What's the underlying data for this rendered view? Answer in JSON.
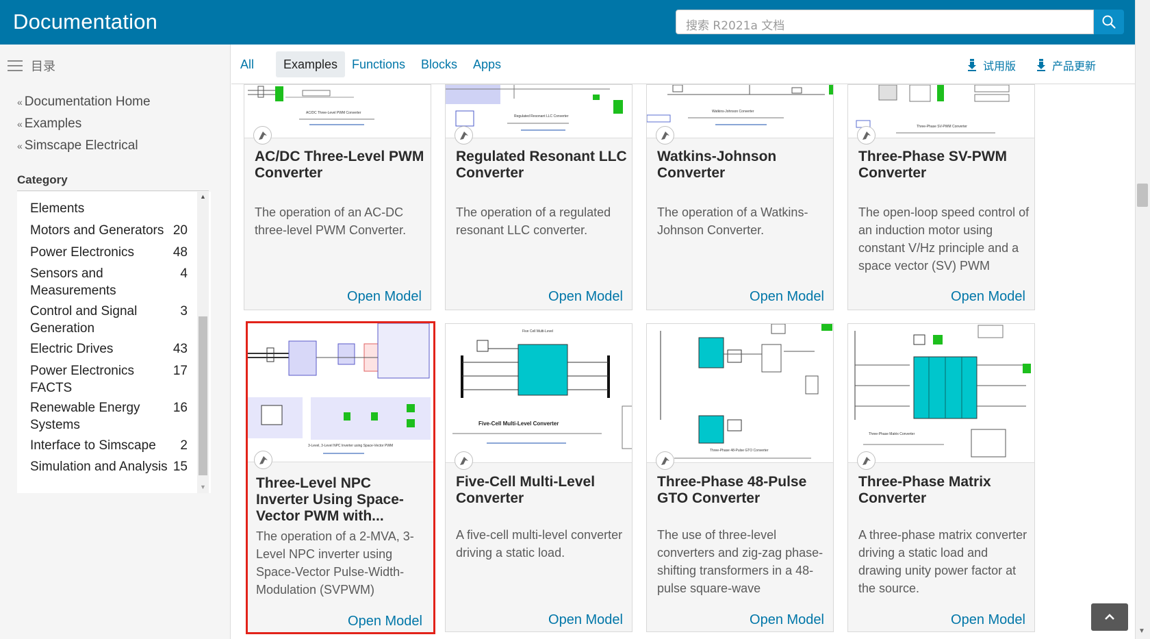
{
  "header": {
    "brand": "Documentation",
    "search_placeholder": "搜索 R2021a 文档"
  },
  "sidebar": {
    "toc_label": "目录",
    "breadcrumbs": [
      "Documentation Home",
      "Examples",
      "Simscape Electrical"
    ],
    "category_title": "Category",
    "categories": [
      {
        "name": "Elements",
        "count": ""
      },
      {
        "name": "Motors and Generators",
        "count": "20"
      },
      {
        "name": "Power Electronics",
        "count": "48"
      },
      {
        "name": "Sensors and Measurements",
        "count": "4"
      },
      {
        "name": "Control and Signal Generation",
        "count": "3"
      },
      {
        "name": "Electric Drives",
        "count": "43"
      },
      {
        "name": "Power Electronics FACTS",
        "count": "17"
      },
      {
        "name": "Renewable Energy Systems",
        "count": "16"
      },
      {
        "name": "Interface to Simscape",
        "count": "2"
      },
      {
        "name": "Simulation and Analysis",
        "count": "15"
      }
    ]
  },
  "tabs": {
    "items": [
      "All",
      "Examples",
      "Functions",
      "Blocks",
      "Apps"
    ],
    "active": "Examples",
    "trial": "试用版",
    "updates": "产品更新"
  },
  "cards": [
    {
      "title": "AC/DC Three-Level PWM Converter",
      "desc": "The operation of an AC-DC three-level PWM Converter.",
      "link": "Open Model",
      "thumb_caption": "AC/DC Three-Level PWM Converter"
    },
    {
      "title": "Regulated Resonant LLC Converter",
      "desc": "The operation of a regulated resonant LLC converter.",
      "link": "Open Model",
      "thumb_caption": "Regulated Resonant LLC Converter"
    },
    {
      "title": "Watkins-Johnson Converter",
      "desc": "The operation of a Watkins-Johnson Converter.",
      "link": "Open Model",
      "thumb_caption": "Watkins-Johnson Converter"
    },
    {
      "title": "Three-Phase SV-PWM Converter",
      "desc": "The open-loop speed control of an induction motor using constant V/Hz principle and a space vector (SV) PWM",
      "link": "Open Model",
      "thumb_caption": "Three-Phase SV-PWM Converter"
    },
    {
      "title": "Three-Level NPC Inverter Using Space-Vector PWM with...",
      "desc": "The operation of a 2-MVA, 3-Level NPC inverter using Space-Vector Pulse-Width-Modulation (SVPWM)",
      "link": "Open Model",
      "thumb_caption": "3-Level, 3-Level NPC Inverter using Space-Vector PWM"
    },
    {
      "title": "Five-Cell Multi-Level Converter",
      "desc": "A five-cell multi-level converter driving a static load.",
      "link": "Open Model",
      "thumb_caption": "Five-Cell Multi-Level Converter"
    },
    {
      "title": "Three-Phase 48-Pulse GTO Converter",
      "desc": "The use of three-level converters and zig-zag phase-shifting transformers in a 48-pulse square-wave",
      "link": "Open Model",
      "thumb_caption": "Three-Phase 48-Pulse GTO Converter"
    },
    {
      "title": "Three-Phase Matrix Converter",
      "desc": "A three-phase matrix converter driving a static load and drawing unity power factor at the source.",
      "link": "Open Model",
      "thumb_caption": "Three-Phase Matrix Converter"
    }
  ],
  "colors": {
    "header": "#0076a8",
    "link": "#0076a8",
    "selected_border": "#e2231a",
    "model_cyan": "#00c6cc",
    "signal_green": "#1dbf1d"
  }
}
